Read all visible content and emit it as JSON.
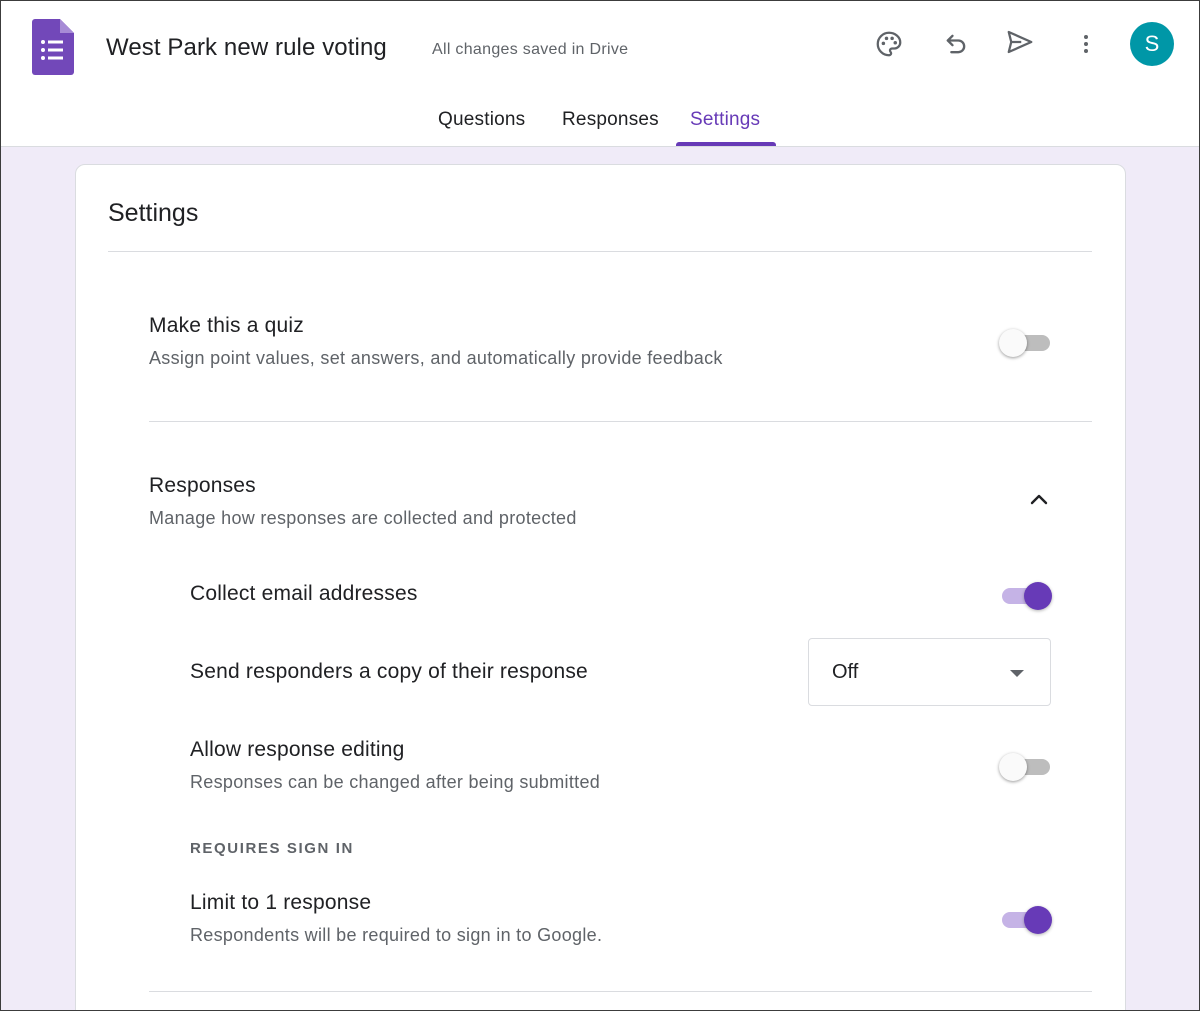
{
  "header": {
    "doc_title": "West Park new rule voting",
    "save_status": "All changes saved in Drive",
    "avatar_letter": "S",
    "icons": [
      "palette-icon",
      "undo-icon",
      "send-icon",
      "more-vert-icon"
    ]
  },
  "tabs": [
    {
      "label": "Questions",
      "active": false
    },
    {
      "label": "Responses",
      "active": false
    },
    {
      "label": "Settings",
      "active": true
    }
  ],
  "settings": {
    "title": "Settings",
    "quiz": {
      "title": "Make this a quiz",
      "description": "Assign point values, set answers, and automatically provide feedback",
      "enabled": false
    },
    "responses": {
      "title": "Responses",
      "description": "Manage how responses are collected and protected",
      "expanded": true,
      "collect_email": {
        "label": "Collect email addresses",
        "enabled": true
      },
      "send_copy": {
        "label": "Send responders a copy of their response",
        "value": "Off"
      },
      "allow_editing": {
        "label": "Allow response editing",
        "description": "Responses can be changed after being submitted",
        "enabled": false
      },
      "requires_sign_in_label": "REQUIRES SIGN IN",
      "limit_one": {
        "label": "Limit to 1 response",
        "description": "Respondents will be required to sign in to Google.",
        "enabled": true
      }
    }
  },
  "colors": {
    "accent": "#673ab7",
    "page_background": "#f0ebf8",
    "avatar": "#0097a7",
    "toggle_on_track": "#c5b3e6",
    "toggle_off_track": "#bdbdbd"
  }
}
